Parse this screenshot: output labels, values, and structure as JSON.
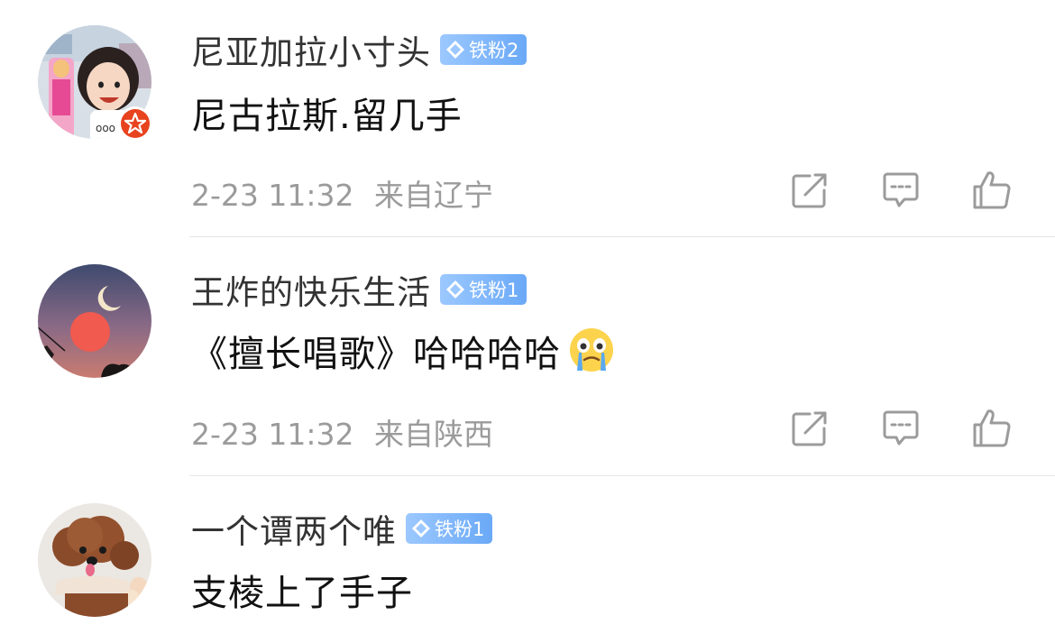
{
  "comments": [
    {
      "username": "尼亚加拉小寸头",
      "fan_badge": "铁粉2",
      "content": "尼古拉斯.留几手",
      "time": "2-23 11:32",
      "location": "来自辽宁",
      "avatar_icon": "girl-with-doll-avatar",
      "has_vip_badge": true
    },
    {
      "username": "王炸的快乐生活",
      "fan_badge": "铁粉1",
      "content": "《擅长唱歌》哈哈哈哈",
      "emoji": "crying-face-emoji",
      "time": "2-23 11:32",
      "location": "来自陕西",
      "avatar_icon": "sunset-moon-avatar"
    },
    {
      "username": "一个谭两个唯",
      "fan_badge": "铁粉1",
      "content": "支棱上了手子",
      "avatar_icon": "poodle-dog-avatar"
    }
  ],
  "colors": {
    "badge_blue": "#6aa9f7",
    "meta_gray": "#9b9b9b",
    "vip_red": "#e8431f"
  }
}
